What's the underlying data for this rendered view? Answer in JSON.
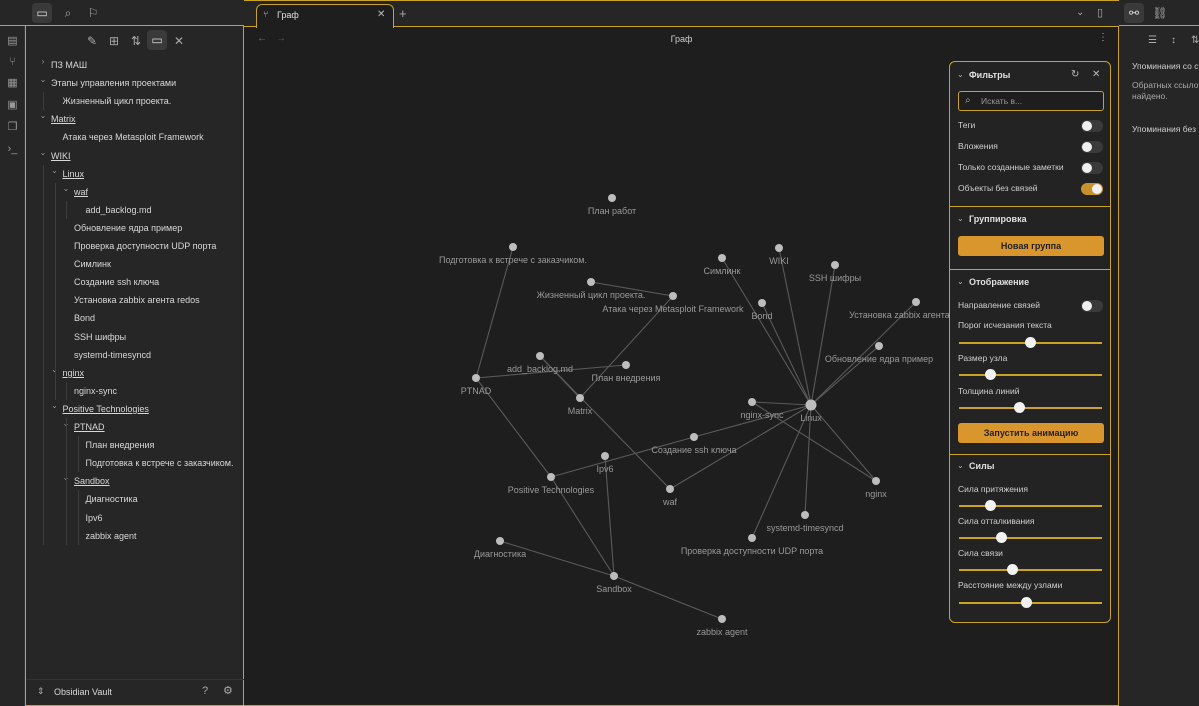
{
  "sidebar": {
    "tree": [
      {
        "label": "ПЗ МАШ",
        "depth": 0,
        "chevron": "right",
        "underline": false
      },
      {
        "label": "Этапы управления проектами",
        "depth": 0,
        "chevron": "down",
        "underline": false
      },
      {
        "label": "Жизненный цикл проекта.",
        "depth": 1,
        "chevron": "",
        "underline": false
      },
      {
        "label": "Matrix",
        "depth": 0,
        "chevron": "down",
        "underline": true
      },
      {
        "label": "Атака через Metasploit Framework",
        "depth": 1,
        "chevron": "",
        "underline": false
      },
      {
        "label": "WIKI",
        "depth": 0,
        "chevron": "down",
        "underline": true
      },
      {
        "label": "Linux",
        "depth": 1,
        "chevron": "down",
        "underline": true
      },
      {
        "label": "waf",
        "depth": 2,
        "chevron": "down",
        "underline": true
      },
      {
        "label": "add_backlog.md",
        "depth": 3,
        "chevron": "",
        "underline": false
      },
      {
        "label": "Обновление ядра пример",
        "depth": 2,
        "chevron": "",
        "underline": false
      },
      {
        "label": "Проверка доступности UDP порта",
        "depth": 2,
        "chevron": "",
        "underline": false
      },
      {
        "label": "Симлинк",
        "depth": 2,
        "chevron": "",
        "underline": false
      },
      {
        "label": "Создание ssh ключа",
        "depth": 2,
        "chevron": "",
        "underline": false
      },
      {
        "label": "Установка zabbix агента redos",
        "depth": 2,
        "chevron": "",
        "underline": false
      },
      {
        "label": "Bond",
        "depth": 2,
        "chevron": "",
        "underline": false
      },
      {
        "label": "SSH шифры",
        "depth": 2,
        "chevron": "",
        "underline": false
      },
      {
        "label": "systemd-timesyncd",
        "depth": 2,
        "chevron": "",
        "underline": false
      },
      {
        "label": "nginx",
        "depth": 1,
        "chevron": "down",
        "underline": true
      },
      {
        "label": "nginx-sync",
        "depth": 2,
        "chevron": "",
        "underline": false
      },
      {
        "label": "Positive Technologies",
        "depth": 1,
        "chevron": "down",
        "underline": true
      },
      {
        "label": "PTNAD",
        "depth": 2,
        "chevron": "down",
        "underline": true
      },
      {
        "label": "План внедрения",
        "depth": 3,
        "chevron": "",
        "underline": false
      },
      {
        "label": "Подготовка к встрече с заказчиком.",
        "depth": 3,
        "chevron": "",
        "underline": false
      },
      {
        "label": "Sandbox",
        "depth": 2,
        "chevron": "down",
        "underline": true
      },
      {
        "label": "Диагностика",
        "depth": 3,
        "chevron": "",
        "underline": false
      },
      {
        "label": "Ipv6",
        "depth": 3,
        "chevron": "",
        "underline": false
      },
      {
        "label": "zabbix agent",
        "depth": 3,
        "chevron": "",
        "underline": false
      }
    ],
    "vault_name": "Obsidian Vault"
  },
  "tab": {
    "label": "Граф"
  },
  "view_title": "Граф",
  "graph": {
    "nodes": [
      {
        "id": "plan_rabot",
        "label": "План работ"
      },
      {
        "id": "podgotovka",
        "label": "Подготовка к встрече с заказчиком."
      },
      {
        "id": "zhiznenny",
        "label": "Жизненный цикл проекта."
      },
      {
        "id": "ataka",
        "label": "Атака через Metasploit Framework"
      },
      {
        "id": "simlink",
        "label": "Симлинк"
      },
      {
        "id": "wiki",
        "label": "WIKI"
      },
      {
        "id": "ssh_shifry",
        "label": "SSH шифры"
      },
      {
        "id": "bond",
        "label": "Bond"
      },
      {
        "id": "zabbix_redos",
        "label": "Установка zabbix агента redos"
      },
      {
        "id": "obnovlenie",
        "label": "Обновление ядра пример"
      },
      {
        "id": "add_backlog",
        "label": "add_backlog.md"
      },
      {
        "id": "plan_vnedr",
        "label": "План внедрения"
      },
      {
        "id": "ptnad",
        "label": "PTNAD"
      },
      {
        "id": "matrix",
        "label": "Matrix"
      },
      {
        "id": "nginx_sync",
        "label": "nginx-sync"
      },
      {
        "id": "linux",
        "label": "Linux"
      },
      {
        "id": "ssh_kluch",
        "label": "Создание ssh ключа"
      },
      {
        "id": "ipv6",
        "label": "Ipv6"
      },
      {
        "id": "positive",
        "label": "Positive Technologies"
      },
      {
        "id": "waf",
        "label": "waf"
      },
      {
        "id": "nginx",
        "label": "nginx"
      },
      {
        "id": "systemd",
        "label": "systemd-timesyncd"
      },
      {
        "id": "udp",
        "label": "Проверка доступности UDP порта"
      },
      {
        "id": "diagnostika",
        "label": "Диагностика"
      },
      {
        "id": "sandbox",
        "label": "Sandbox"
      },
      {
        "id": "zabbix_agent",
        "label": "zabbix agent"
      }
    ],
    "edges": [
      [
        "podgotovka",
        "ptnad"
      ],
      [
        "ptnad",
        "plan_vnedr"
      ],
      [
        "ptnad",
        "positive"
      ],
      [
        "zhiznenny",
        "ataka"
      ],
      [
        "ataka",
        "matrix"
      ],
      [
        "matrix",
        "add_backlog"
      ],
      [
        "add_backlog",
        "waf"
      ],
      [
        "waf",
        "linux"
      ],
      [
        "simlink",
        "linux"
      ],
      [
        "wiki",
        "linux"
      ],
      [
        "ssh_shifry",
        "linux"
      ],
      [
        "bond",
        "linux"
      ],
      [
        "zabbix_redos",
        "linux"
      ],
      [
        "obnovlenie",
        "linux"
      ],
      [
        "nginx_sync",
        "linux"
      ],
      [
        "ssh_kluch",
        "linux"
      ],
      [
        "systemd",
        "linux"
      ],
      [
        "udp",
        "linux"
      ],
      [
        "nginx",
        "linux"
      ],
      [
        "nginx_sync",
        "nginx"
      ],
      [
        "ssh_kluch",
        "positive"
      ],
      [
        "positive",
        "sandbox"
      ],
      [
        "ipv6",
        "sandbox"
      ],
      [
        "diagnostika",
        "sandbox"
      ],
      [
        "sandbox",
        "zabbix_agent"
      ]
    ]
  },
  "filters": {
    "header": "Фильтры",
    "search_placeholder": "Искать в...",
    "toggles": [
      {
        "label": "Теги",
        "on": false
      },
      {
        "label": "Вложения",
        "on": false
      },
      {
        "label": "Только созданные заметки",
        "on": false
      },
      {
        "label": "Объекты без связей",
        "on": true
      }
    ]
  },
  "grouping": {
    "header": "Группировка",
    "button": "Новая группа"
  },
  "display": {
    "header": "Отображение",
    "arrows_label": "Направление связей",
    "arrows_on": false,
    "sliders": [
      {
        "label": "Порог исчезания текста",
        "value": 0.5
      },
      {
        "label": "Размер узла",
        "value": 0.2
      },
      {
        "label": "Толщина линий",
        "value": 0.42
      }
    ],
    "animate_button": "Запустить анимацию"
  },
  "forces": {
    "header": "Силы",
    "sliders": [
      {
        "label": "Сила притяжения",
        "value": 0.2
      },
      {
        "label": "Сила отталкивания",
        "value": 0.28
      },
      {
        "label": "Сила связи",
        "value": 0.36
      },
      {
        "label": "Расстояние между узлами",
        "value": 0.47
      }
    ]
  },
  "right_panel": {
    "line1": "Упоминания со с",
    "line2": "Обратных ссыло",
    "line3": "найдено.",
    "line4": "Упоминания без"
  }
}
